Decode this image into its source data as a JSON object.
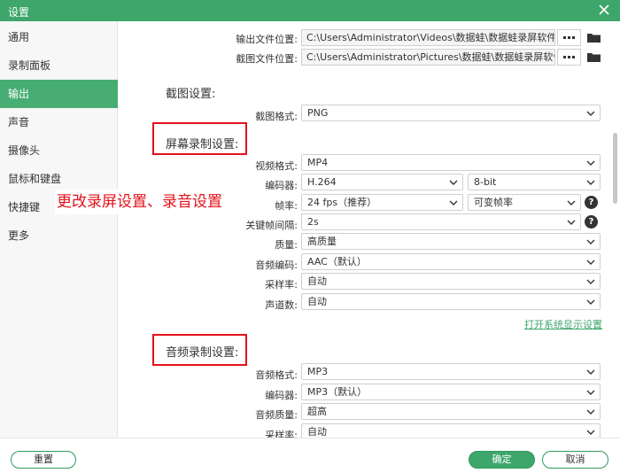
{
  "window": {
    "title": "设置"
  },
  "sidebar": {
    "items": [
      {
        "label": "通用"
      },
      {
        "label": "录制面板"
      },
      {
        "label": "输出",
        "active": true
      },
      {
        "label": "声音"
      },
      {
        "label": "摄像头"
      },
      {
        "label": "鼠标和键盘"
      },
      {
        "label": "快捷键"
      },
      {
        "label": "更多"
      }
    ]
  },
  "output": {
    "file_location_label": "输出文件位置:",
    "file_location_value": "C:\\Users\\Administrator\\Videos\\数据蛙\\数据蛙录屏软件",
    "screenshot_location_label": "截图文件位置:",
    "screenshot_location_value": "C:\\Users\\Administrator\\Pictures\\数据蛙\\数据蛙录屏软件"
  },
  "screenshot_settings": {
    "heading": "截图设置:",
    "format_label": "截图格式:",
    "format_value": "PNG"
  },
  "screen_recording": {
    "heading": "屏幕录制设置:",
    "video_format_label": "视频格式:",
    "video_format_value": "MP4",
    "encoder_label": "编码器:",
    "encoder_value": "H.264",
    "bit_depth_value": "8-bit",
    "frame_rate_label": "帧率:",
    "frame_rate_value": "24 fps（推荐）",
    "frame_rate_mode_value": "可变帧率",
    "keyframe_label": "关键帧间隔:",
    "keyframe_value": "2s",
    "quality_label": "质量:",
    "quality_value": "高质量",
    "audio_codec_label": "音频编码:",
    "audio_codec_value": "AAC（默认）",
    "sample_rate_label": "采样率:",
    "sample_rate_value": "自动",
    "channels_label": "声道数:",
    "channels_value": "自动",
    "display_settings_link": "打开系统显示设置"
  },
  "audio_recording": {
    "heading": "音频录制设置:",
    "audio_format_label": "音频格式:",
    "audio_format_value": "MP3",
    "encoder_label": "编码器:",
    "encoder_value": "MP3（默认）",
    "audio_quality_label": "音频质量:",
    "audio_quality_value": "超高",
    "sample_rate_label": "采样率:",
    "sample_rate_value": "自动"
  },
  "annotation": {
    "text": "更改录屏设置、录音设置"
  },
  "footer": {
    "reset_label": "重置",
    "confirm_label": "确定",
    "cancel_label": "取消"
  },
  "colors": {
    "accent": "#3ea66b",
    "highlight": "#e3111b"
  },
  "icons": [
    "close-icon",
    "more-dots-icon",
    "folder-icon",
    "chevron-down-icon",
    "help-icon"
  ]
}
